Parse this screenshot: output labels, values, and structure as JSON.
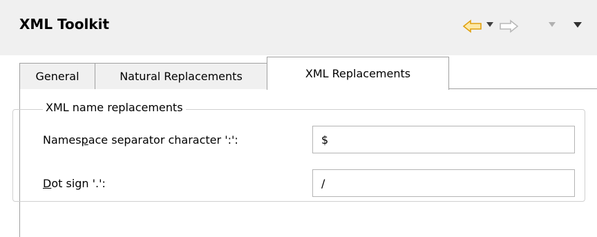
{
  "view": {
    "title": "XML Toolkit",
    "nav": {
      "back_icon": "back-arrow-icon",
      "forward_icon": "forward-arrow-icon",
      "accent_back": "#e8a317",
      "disabled_color": "#b0b0b0"
    }
  },
  "tabs": [
    {
      "label": "General",
      "selected": false
    },
    {
      "label": "Natural Replacements",
      "selected": false
    },
    {
      "label": "XML Replacements",
      "selected": true
    }
  ],
  "group": {
    "legend": "XML name replacements",
    "fields": [
      {
        "label_pre": "Names",
        "label_mnemonic": "p",
        "label_post": "ace separator character ':':",
        "value": "$"
      },
      {
        "label_pre": "",
        "label_mnemonic": "D",
        "label_post": "ot sign '.':",
        "value": "/"
      }
    ]
  }
}
